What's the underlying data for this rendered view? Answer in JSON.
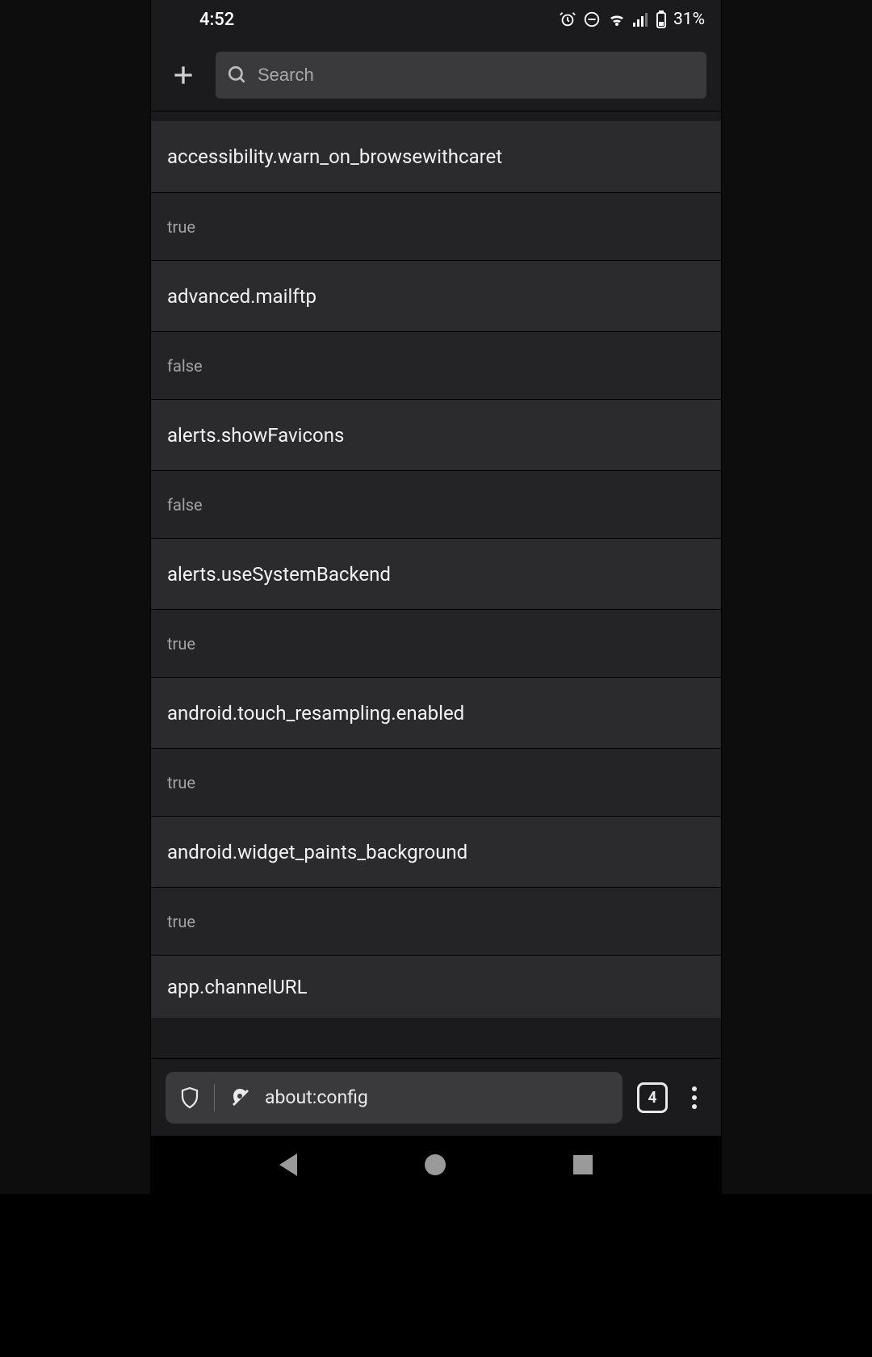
{
  "statusbar": {
    "time": "4:52",
    "battery_text": "31%"
  },
  "toolbar": {
    "search_placeholder": "Search"
  },
  "prefs": [
    {
      "key": "accessibility.warn_on_browsewithcaret",
      "value": "true"
    },
    {
      "key": "advanced.mailftp",
      "value": "false"
    },
    {
      "key": "alerts.showFavicons",
      "value": "false"
    },
    {
      "key": "alerts.useSystemBackend",
      "value": "true"
    },
    {
      "key": "android.touch_resampling.enabled",
      "value": "true"
    },
    {
      "key": "android.widget_paints_background",
      "value": "true"
    },
    {
      "key": "app.channelURL",
      "value": ""
    }
  ],
  "addressbar": {
    "url": "about:config",
    "tab_count": "4"
  }
}
